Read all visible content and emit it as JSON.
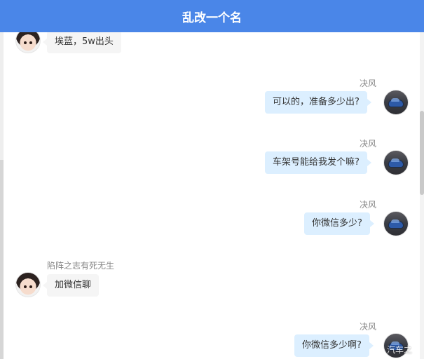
{
  "header": {
    "title": "乱改一个名"
  },
  "messages": [
    {
      "side": "received",
      "nickname": "",
      "text": "埃蓝，5w出头"
    },
    {
      "side": "sent",
      "nickname": "决风",
      "text": "可以的，准备多少出?"
    },
    {
      "side": "sent",
      "nickname": "决风",
      "text": "车架号能给我发个嘛?"
    },
    {
      "side": "sent",
      "nickname": "决风",
      "text": "你微信多少?"
    },
    {
      "side": "received",
      "nickname": "陷阵之志有死无生",
      "text": "加微信聊"
    },
    {
      "side": "sent",
      "nickname": "决风",
      "text": "你微信多少啊?"
    }
  ],
  "watermark": {
    "text": "汽车之"
  },
  "colors": {
    "header_bg": "#4a86e8",
    "sent_bubble": "#dcefff",
    "received_bubble": "#f5f5f5"
  }
}
